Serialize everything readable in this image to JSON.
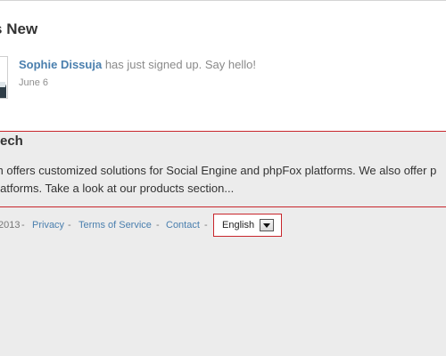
{
  "whats_new": {
    "title": "'s New",
    "feed": [
      {
        "user": "Sophie Dissuja",
        "action": "has just signed up. Say hello!",
        "date": "June 6"
      }
    ]
  },
  "company": {
    "title": "tech",
    "description_lines": [
      "ch offers customized solutions for Social Engine and phpFox platforms. We also offer p",
      "platforms. Take a look at our products section..."
    ]
  },
  "footer": {
    "copyright": "2013",
    "separator": "-",
    "links": {
      "privacy": "Privacy",
      "terms": "Terms of Service",
      "contact": "Contact"
    },
    "language": {
      "selected": "English"
    }
  },
  "colors": {
    "accent_red": "#c8262c",
    "link_blue": "#4a7fae",
    "background": "#ececec"
  }
}
